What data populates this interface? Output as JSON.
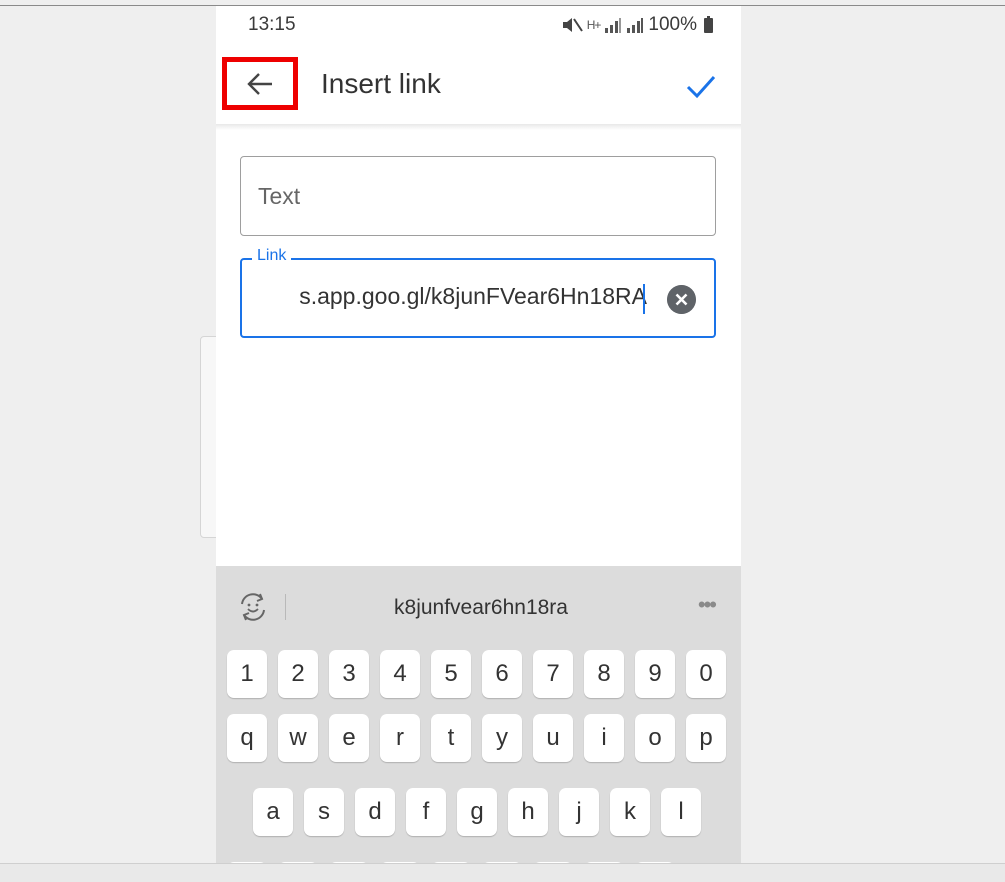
{
  "status": {
    "time": "13:15",
    "signal_text": "H+",
    "battery": "100%"
  },
  "app_bar": {
    "title": "Insert link"
  },
  "text_field": {
    "placeholder": "Text"
  },
  "link_field": {
    "label": "Link",
    "value": "s.app.goo.gl/k8junFVear6Hn18RA"
  },
  "keyboard": {
    "suggestion": "k8junfvear6hn18ra",
    "more": "•••",
    "rows": [
      [
        "1",
        "2",
        "3",
        "4",
        "5",
        "6",
        "7",
        "8",
        "9",
        "0"
      ],
      [
        "q",
        "w",
        "e",
        "r",
        "t",
        "y",
        "u",
        "i",
        "o",
        "p"
      ],
      [
        "a",
        "s",
        "d",
        "f",
        "g",
        "h",
        "j",
        "k",
        "l"
      ]
    ]
  },
  "colors": {
    "accent": "#1a73e8",
    "highlight_box": "#ee0000",
    "keyboard_bg": "#dcdcdc"
  },
  "icons": [
    "back-arrow-icon",
    "checkmark-icon",
    "clear-icon",
    "emoji-sync-icon",
    "mute-icon",
    "battery-icon"
  ]
}
